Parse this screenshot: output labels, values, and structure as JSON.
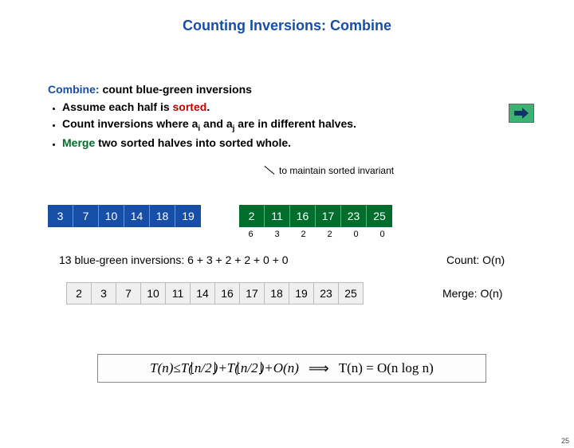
{
  "title": "Counting Inversions:  Combine",
  "combine": {
    "label": "Combine:",
    "desc": "  count blue-green inversions",
    "bullets": [
      {
        "pre": "Assume each half is ",
        "em": "sorted",
        "post": "."
      },
      {
        "pre": "Count inversions where a",
        "sub1": "i",
        "mid": " and a",
        "sub2": "j",
        "post": " are in different halves."
      },
      {
        "pre": "",
        "em": "Merge",
        "post": " two sorted halves into sorted whole."
      }
    ]
  },
  "annotation": "to maintain sorted invariant",
  "left_array": [
    "3",
    "7",
    "10",
    "14",
    "18",
    "19"
  ],
  "right_array": [
    "2",
    "11",
    "16",
    "17",
    "23",
    "25"
  ],
  "counts_below": [
    "6",
    "3",
    "2",
    "2",
    "0",
    "0"
  ],
  "inversions_line": "13 blue-green inversions:  6 + 3 + 2 + 2 + 0 + 0",
  "count_complexity": "Count:  O(n)",
  "merged_array": [
    "2",
    "3",
    "7",
    "10",
    "11",
    "14",
    "16",
    "17",
    "18",
    "19",
    "23",
    "25"
  ],
  "merge_complexity": "Merge:  O(n)",
  "recurrence": {
    "lhs": "T(n)",
    "le": " ≤ ",
    "t1": "T(",
    "floor": "n/2",
    "t2": ")+T(",
    "ceil": "n/2",
    "t3": ")+O(n)",
    "rhs": "T(n) = O(n log n)"
  },
  "page_number": "25"
}
